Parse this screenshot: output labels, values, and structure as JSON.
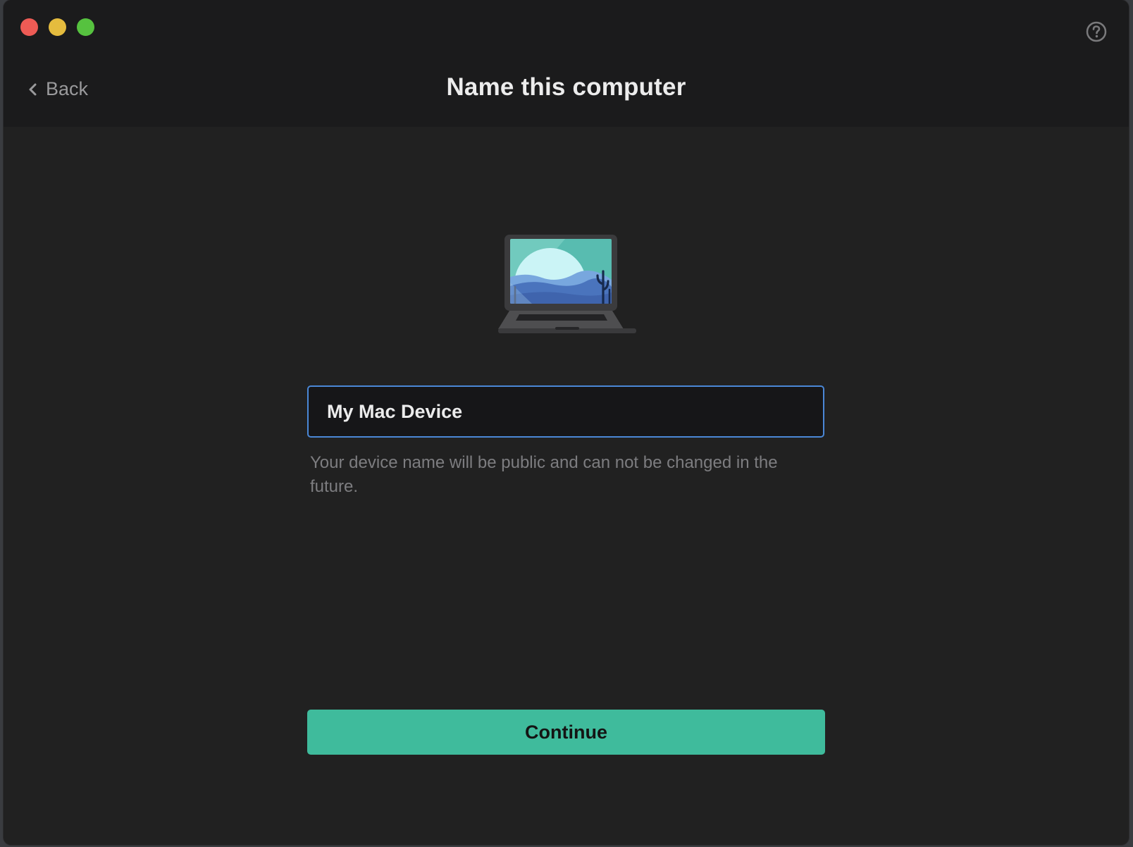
{
  "window": {
    "traffic_lights": [
      {
        "name": "close",
        "color": "#ee5b55"
      },
      {
        "name": "minimize",
        "color": "#e5bc3e"
      },
      {
        "name": "zoom",
        "color": "#56c23f"
      }
    ]
  },
  "header": {
    "back_label": "Back",
    "back_icon": "chevron-left-icon",
    "title": "Name this computer",
    "help_icon": "help-circle-icon"
  },
  "main": {
    "illustration_icon": "laptop-illustration-icon",
    "device_name": {
      "value": "My Mac Device",
      "placeholder": ""
    },
    "hint": "Your device name will be public and can not be changed in the future.",
    "continue_label": "Continue"
  },
  "colors": {
    "accent": "#3fbb9c",
    "focus_border": "#4a87d6",
    "background": "#212121",
    "header_background": "#1b1b1c"
  }
}
